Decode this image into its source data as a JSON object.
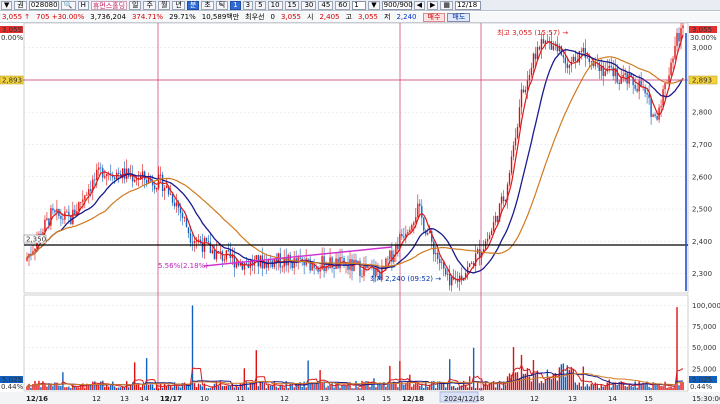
{
  "toolbar": {
    "items": [
      "▼",
      "권",
      "028080",
      "🔍",
      "H",
      "휴먼스홀딩",
      "일",
      "주",
      "월",
      "년",
      "분",
      "초",
      "틱",
      "1",
      "3",
      "5",
      "10",
      "15",
      "30",
      "45",
      "60",
      "1",
      "▼",
      "900/900",
      "◀",
      "▶",
      "▦",
      "12/18"
    ],
    "code": "028080",
    "name": "휴먼스홀딩",
    "counter": "900/900",
    "date": "12/18",
    "period_tabs": [
      "일",
      "주",
      "월",
      "년",
      "분",
      "초",
      "틱"
    ],
    "active_period": "분",
    "intervals": [
      "1",
      "3",
      "5",
      "10",
      "15",
      "30",
      "45",
      "60"
    ],
    "active_interval": "1",
    "unit": "1"
  },
  "quote": {
    "price": "3,055 ↑",
    "change": "705 +30.00%",
    "volume": "3,736,204",
    "vol_ratio": "374.71%",
    "turnover_pct": "29.71%",
    "amount": "10,589백만",
    "priority_label": "최우선",
    "priority_value": "0",
    "current": "3,055",
    "open_label": "시",
    "open_value": "2,405",
    "high_label": "고",
    "high_value": "3,055",
    "low_label": "저",
    "low_value": "2,240",
    "buy_label": "매수",
    "sell_label": "매도"
  },
  "colors": {
    "candle_up": "#e01010",
    "candle_down": "#1060c0",
    "ma_red": "#d81b1b",
    "ma_navy": "#1a1a8c",
    "ma_orange": "#d07a20",
    "trendline": "#d030d0",
    "support": "#000000",
    "crosshair": "#c8326e",
    "price_tag_bg": "#e03030",
    "current_tag_bg": "#f4d33c"
  },
  "chart_data": {
    "type": "candlestick",
    "y_price_ticks": [
      "3,000",
      "2,900",
      "2,800",
      "2,700",
      "2,600",
      "2,500",
      "2,400",
      "2,300"
    ],
    "y_volume_ticks": [
      "100,000",
      "75,000",
      "50,000",
      "25,000"
    ],
    "date_labels": [
      "12/16",
      "12",
      "13",
      "14",
      "15",
      "12/17",
      "10",
      "11",
      "12",
      "13",
      "14",
      "15",
      "12/18",
      "2024/12/18",
      "12",
      "13",
      "14",
      "15",
      "15:30:00"
    ],
    "left_price_top": "3,055",
    "left_pct_top": "0.00%",
    "left_price_mid": "2,893",
    "left_price_support": "2,350",
    "left_vol": "5,025",
    "left_vol_pct": "0.44%",
    "right_price_top": "3,055",
    "right_pct_top": "30.00%",
    "right_price_mid": "2,893",
    "right_vol": "5,025",
    "right_vol_pct": "0.44%",
    "high_label": "최고 3,055 (15:57) →",
    "low_label": "최저 2,240 (09:52) →",
    "trend_label": "5.56%(2.18%)",
    "ylim": [
      2240,
      3070
    ],
    "volume_max": 110000
  }
}
